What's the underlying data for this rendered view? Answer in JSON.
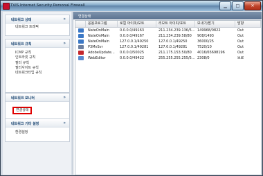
{
  "window": {
    "title": "TVIS Internet Security Personal Firewall"
  },
  "sidebar": {
    "panels": [
      {
        "title": "네트워크 상태",
        "items": [
          "네트워크 트래픽"
        ]
      },
      {
        "title": "네트워크 규칙",
        "items": [
          "ICMP 규칙",
          "인트라넷 규칙",
          "필터 규칙",
          "필터사이트 규칙",
          "네트워크타입 규칙"
        ]
      },
      {
        "title": "네트워크 모니터",
        "items": [
          "연결상태"
        ]
      },
      {
        "title": "네트워크 기타 설정",
        "items": [
          "환경설정"
        ]
      }
    ]
  },
  "content": {
    "title": "연결상태",
    "columns": [
      "응용프로그램",
      "로컬 아이피/포트",
      "리모트 아이피/포트",
      "보내기/받기",
      "방향"
    ],
    "rows": [
      {
        "app": "NateOnMain",
        "local": "0.0.0.0/49163",
        "remote": "211.234.239.136/5...",
        "sendrecv": "149968/0822",
        "dir": "Out",
        "icon_color": "#3b78c6"
      },
      {
        "app": "NateOnMain",
        "local": "0.0.0.0/49167",
        "remote": "211.234.239.58/80",
        "sendrecv": "908/1493",
        "dir": "Out",
        "icon_color": "#3b78c6"
      },
      {
        "app": "NateOnMain",
        "local": "127.0.0.1/49250",
        "remote": "127.0.0.1/49250",
        "sendrecv": "36000/25",
        "dir": "Out",
        "icon_color": "#3b78c6"
      },
      {
        "app": "P3MvSvr",
        "local": "127.0.0.1/49281",
        "remote": "127.0.0.1/49281",
        "sendrecv": "7520/10",
        "dir": "Out",
        "icon_color": "#6c7fa0"
      },
      {
        "app": "AdobeUpdate...",
        "local": "0.0.0.0/50025",
        "remote": "211.175.153.50/80",
        "sendrecv": "4016/65698196",
        "dir": "Out",
        "icon_color": "#c3262c"
      },
      {
        "app": "WebEditor",
        "local": "0.0.0.0/49422",
        "remote": "255.255.255.255/5...",
        "sendrecv": "2308/0",
        "dir": "브로",
        "icon_color": "#5a8ad0"
      }
    ]
  }
}
